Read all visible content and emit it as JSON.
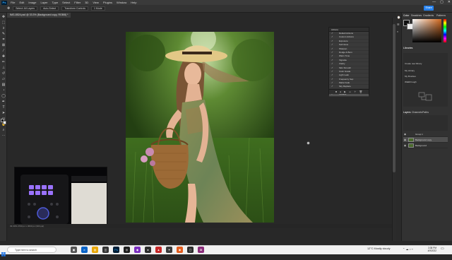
{
  "app": {
    "logo": "Ps",
    "menus": [
      "File",
      "Edit",
      "Image",
      "Layer",
      "Type",
      "Select",
      "Filter",
      "3D",
      "View",
      "Plugins",
      "Window",
      "Help"
    ],
    "window_controls": [
      "—",
      "▢",
      "✕"
    ]
  },
  "options_bar": {
    "fields": [
      "Select: All Layers",
      "Auto-Select",
      "Transform Controls",
      "1 Mode"
    ],
    "share_label": "Share"
  },
  "document": {
    "tab_title": "IMG-8524.psd @ 33.3% (Background copy, RGB/8) *",
    "status_text": "33.33%   2700 px x 3600 px (300 ppi)"
  },
  "actions_panel": {
    "title": "Actions",
    "items": [
      {
        "label": "Default Actions",
        "selected": false
      },
      {
        "label": "Custom Actions",
        "selected": false
      },
      {
        "label": "Exposure",
        "selected": false
      },
      {
        "label": "Soft Glow",
        "selected": false
      },
      {
        "label": "Sharpen",
        "selected": false
      },
      {
        "label": "Dodge & Burn",
        "selected": false
      },
      {
        "label": "Warm Tone",
        "selected": false
      },
      {
        "label": "Vignette",
        "selected": false
      },
      {
        "label": "Clarity",
        "selected": false
      },
      {
        "label": "Skin Smooth",
        "selected": false
      },
      {
        "label": "Color Grade",
        "selected": false
      },
      {
        "label": "Light Leak",
        "selected": false
      },
      {
        "label": "Frequency Sep",
        "selected": false
      },
      {
        "label": "Matte Fade",
        "selected": false
      },
      {
        "label": "Sky Replace",
        "selected": false
      },
      {
        "label": "Red Eye",
        "selected": false
      },
      {
        "label": "Finalize",
        "selected": true
      }
    ]
  },
  "right_panels": {
    "top_tabs": [
      "Color",
      "Swatches",
      "Gradients",
      "Patterns"
    ],
    "libraries_title": "Libraries",
    "libraries_items": [
      "Create new library",
      "My Library",
      "My Brushes",
      "Walkthrough"
    ],
    "layers_tabs": [
      "Layers",
      "Channels",
      "Paths"
    ],
    "layers": [
      {
        "name": "Group 1",
        "selected": false
      },
      {
        "name": "Background copy",
        "selected": true
      },
      {
        "name": "Background",
        "selected": false
      }
    ]
  },
  "taskbar": {
    "search_placeholder": "Type here to search",
    "weather": "12°C  Mostly cloudy",
    "time": "3:38 PM",
    "date": "4/9/2022"
  },
  "colors": {
    "accent": "#2680eb",
    "ps_bg": "#282828",
    "panel_bg": "#323232"
  }
}
